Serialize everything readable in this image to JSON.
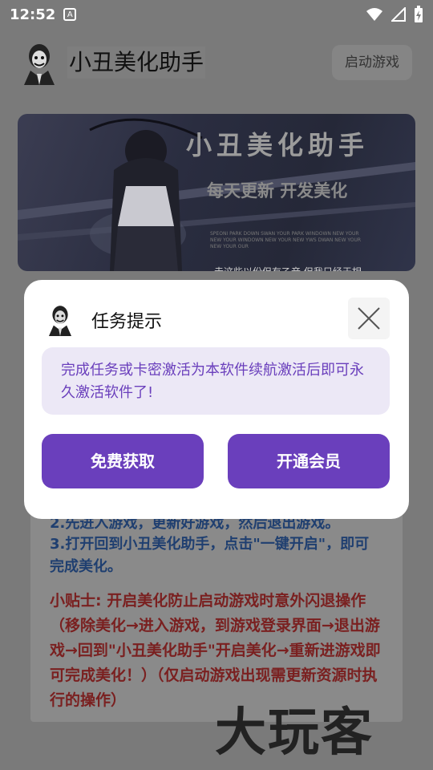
{
  "status_bar": {
    "time": "12:52",
    "notification_icon": "A"
  },
  "header": {
    "title": "小丑美化助手",
    "launch_label": "启动游戏"
  },
  "banner": {
    "title": "小丑美化助手",
    "subtitle": "每天更新 开发美化",
    "fine_print": "SPEONI PARK DOWN SWAN YOUR PARK WINDOWN NEW YOUR NEW YOUR WINDOWN NEW YOUR NEW YWS DWAN NEW YOUR NEW YOUR OUR",
    "cut_text": "走这些以份但有乙音 但我只经于相"
  },
  "background_content": {
    "line1": "2.先进入游戏，更新好游戏，然后退出游戏。",
    "line2": "3.打开回到小丑美化助手，点击\"一键开启\"，即可",
    "line3": "完成美化。",
    "tip": "小贴士: 开启美化防止启动游戏时意外闪退操作（移除美化→进入游戏，到游戏登录界面→退出游戏→回到\"小丑美化助手\"开启美化→重新进游戏即可完成美化！）（仅启动游戏出现需更新资源时执行的操作）"
  },
  "watermark": "大玩客",
  "dialog": {
    "title": "任务提示",
    "message": "完成任务或卡密激活为本软件续航激活后即可永久激活软件了!",
    "free_button": "免费获取",
    "vip_button": "开通会员"
  },
  "colors": {
    "accent": "#6a3fbc",
    "message_bg": "#ece8f6",
    "overlay": "#7a7a7a"
  }
}
